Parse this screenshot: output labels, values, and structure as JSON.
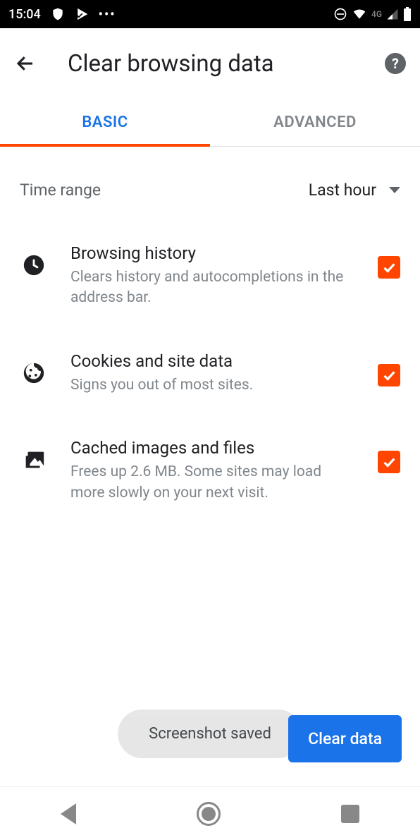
{
  "statusbar": {
    "time": "15:04",
    "network": "4G"
  },
  "appbar": {
    "title": "Clear browsing data"
  },
  "tabs": {
    "basic": "BASIC",
    "advanced": "ADVANCED"
  },
  "timerange": {
    "label": "Time range",
    "value": "Last hour"
  },
  "options": [
    {
      "title": "Browsing history",
      "desc": "Clears history and autocompletions in the address bar."
    },
    {
      "title": "Cookies and site data",
      "desc": "Signs you out of most sites."
    },
    {
      "title": "Cached images and files",
      "desc": "Frees up 2.6 MB. Some sites may load more slowly on your next visit."
    }
  ],
  "toast": "Screenshot saved",
  "fab": "Clear data"
}
